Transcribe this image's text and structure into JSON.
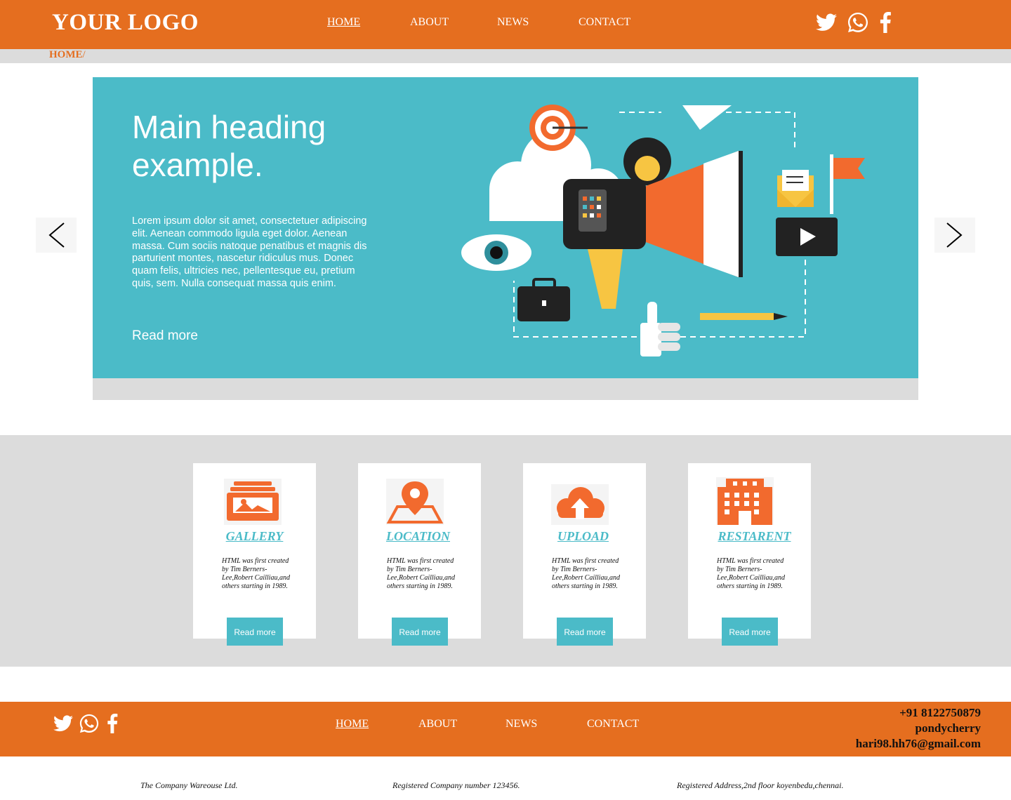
{
  "header": {
    "logo": "YOUR LOGO",
    "nav": [
      "HOME",
      "ABOUT",
      "NEWS",
      "CONTACT"
    ],
    "active_nav": "HOME",
    "social_icons": [
      "twitter-icon",
      "whatsapp-icon",
      "facebook-icon"
    ]
  },
  "breadcrumb": {
    "current": "HOME",
    "separator": "/"
  },
  "hero": {
    "title": "Main heading example.",
    "text": "Lorem ipsum dolor sit amet, consectetuer adipiscing elit. Aenean commodo ligula eget dolor. Aenean massa. Cum sociis natoque penatibus et magnis dis parturient montes, nascetur ridiculus mus. Donec quam felis, ultricies nec, pellentesque eu, pretium quis, sem. Nulla consequat massa quis enim.",
    "read_more": "Read more",
    "prev_icon": "chevron-left-icon",
    "next_icon": "chevron-right-icon"
  },
  "cards": [
    {
      "title": "GALLERY",
      "icon": "gallery-icon",
      "text": "HTML was first created by Tim Berners-Lee,Robert Cailliau,and others starting in 1989.",
      "button": "Read more"
    },
    {
      "title": "LOCATION",
      "icon": "location-pin-icon",
      "text": "HTML was first created by Tim Berners-Lee,Robert Cailliau,and others starting in 1989.",
      "button": "Read more"
    },
    {
      "title": "UPLOAD",
      "icon": "cloud-upload-icon",
      "text": "HTML was first created by Tim Berners-Lee,Robert Cailliau,and others starting in 1989.",
      "button": "Read more"
    },
    {
      "title": "RESTARENT",
      "icon": "building-icon",
      "text": "HTML was first created by Tim Berners-Lee,Robert Cailliau,and others starting in 1989.",
      "button": "Read more"
    }
  ],
  "footer": {
    "nav": [
      "HOME",
      "ABOUT",
      "NEWS",
      "CONTACT"
    ],
    "phone": "+91 8122750879",
    "city": "pondycherry",
    "email": "hari98.hh76@gmail.com",
    "company": "The Company Wareouse Ltd.",
    "reg_number": "Registered Company number 123456.",
    "reg_address": "Registered Address,2nd floor koyenbedu,chennai."
  },
  "colors": {
    "brand": "#e56e1f",
    "accent": "#4bbbc8",
    "band": "#dcdcdc"
  }
}
